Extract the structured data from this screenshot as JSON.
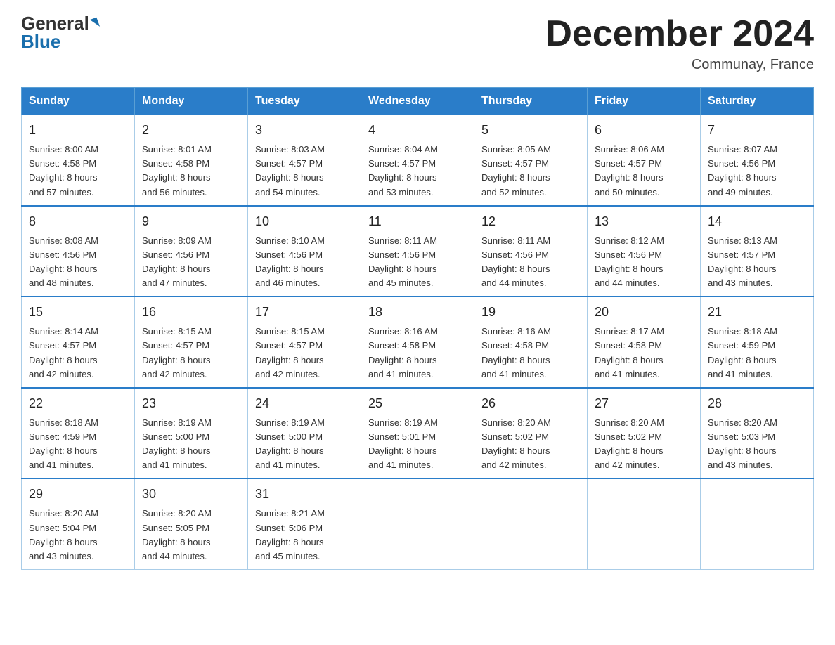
{
  "header": {
    "logo_general": "General",
    "logo_blue": "Blue",
    "month_title": "December 2024",
    "location": "Communay, France"
  },
  "days_of_week": [
    "Sunday",
    "Monday",
    "Tuesday",
    "Wednesday",
    "Thursday",
    "Friday",
    "Saturday"
  ],
  "weeks": [
    [
      {
        "day": "1",
        "sunrise": "8:00 AM",
        "sunset": "4:58 PM",
        "daylight": "8 hours and 57 minutes."
      },
      {
        "day": "2",
        "sunrise": "8:01 AM",
        "sunset": "4:58 PM",
        "daylight": "8 hours and 56 minutes."
      },
      {
        "day": "3",
        "sunrise": "8:03 AM",
        "sunset": "4:57 PM",
        "daylight": "8 hours and 54 minutes."
      },
      {
        "day": "4",
        "sunrise": "8:04 AM",
        "sunset": "4:57 PM",
        "daylight": "8 hours and 53 minutes."
      },
      {
        "day": "5",
        "sunrise": "8:05 AM",
        "sunset": "4:57 PM",
        "daylight": "8 hours and 52 minutes."
      },
      {
        "day": "6",
        "sunrise": "8:06 AM",
        "sunset": "4:57 PM",
        "daylight": "8 hours and 50 minutes."
      },
      {
        "day": "7",
        "sunrise": "8:07 AM",
        "sunset": "4:56 PM",
        "daylight": "8 hours and 49 minutes."
      }
    ],
    [
      {
        "day": "8",
        "sunrise": "8:08 AM",
        "sunset": "4:56 PM",
        "daylight": "8 hours and 48 minutes."
      },
      {
        "day": "9",
        "sunrise": "8:09 AM",
        "sunset": "4:56 PM",
        "daylight": "8 hours and 47 minutes."
      },
      {
        "day": "10",
        "sunrise": "8:10 AM",
        "sunset": "4:56 PM",
        "daylight": "8 hours and 46 minutes."
      },
      {
        "day": "11",
        "sunrise": "8:11 AM",
        "sunset": "4:56 PM",
        "daylight": "8 hours and 45 minutes."
      },
      {
        "day": "12",
        "sunrise": "8:11 AM",
        "sunset": "4:56 PM",
        "daylight": "8 hours and 44 minutes."
      },
      {
        "day": "13",
        "sunrise": "8:12 AM",
        "sunset": "4:56 PM",
        "daylight": "8 hours and 44 minutes."
      },
      {
        "day": "14",
        "sunrise": "8:13 AM",
        "sunset": "4:57 PM",
        "daylight": "8 hours and 43 minutes."
      }
    ],
    [
      {
        "day": "15",
        "sunrise": "8:14 AM",
        "sunset": "4:57 PM",
        "daylight": "8 hours and 42 minutes."
      },
      {
        "day": "16",
        "sunrise": "8:15 AM",
        "sunset": "4:57 PM",
        "daylight": "8 hours and 42 minutes."
      },
      {
        "day": "17",
        "sunrise": "8:15 AM",
        "sunset": "4:57 PM",
        "daylight": "8 hours and 42 minutes."
      },
      {
        "day": "18",
        "sunrise": "8:16 AM",
        "sunset": "4:58 PM",
        "daylight": "8 hours and 41 minutes."
      },
      {
        "day": "19",
        "sunrise": "8:16 AM",
        "sunset": "4:58 PM",
        "daylight": "8 hours and 41 minutes."
      },
      {
        "day": "20",
        "sunrise": "8:17 AM",
        "sunset": "4:58 PM",
        "daylight": "8 hours and 41 minutes."
      },
      {
        "day": "21",
        "sunrise": "8:18 AM",
        "sunset": "4:59 PM",
        "daylight": "8 hours and 41 minutes."
      }
    ],
    [
      {
        "day": "22",
        "sunrise": "8:18 AM",
        "sunset": "4:59 PM",
        "daylight": "8 hours and 41 minutes."
      },
      {
        "day": "23",
        "sunrise": "8:19 AM",
        "sunset": "5:00 PM",
        "daylight": "8 hours and 41 minutes."
      },
      {
        "day": "24",
        "sunrise": "8:19 AM",
        "sunset": "5:00 PM",
        "daylight": "8 hours and 41 minutes."
      },
      {
        "day": "25",
        "sunrise": "8:19 AM",
        "sunset": "5:01 PM",
        "daylight": "8 hours and 41 minutes."
      },
      {
        "day": "26",
        "sunrise": "8:20 AM",
        "sunset": "5:02 PM",
        "daylight": "8 hours and 42 minutes."
      },
      {
        "day": "27",
        "sunrise": "8:20 AM",
        "sunset": "5:02 PM",
        "daylight": "8 hours and 42 minutes."
      },
      {
        "day": "28",
        "sunrise": "8:20 AM",
        "sunset": "5:03 PM",
        "daylight": "8 hours and 43 minutes."
      }
    ],
    [
      {
        "day": "29",
        "sunrise": "8:20 AM",
        "sunset": "5:04 PM",
        "daylight": "8 hours and 43 minutes."
      },
      {
        "day": "30",
        "sunrise": "8:20 AM",
        "sunset": "5:05 PM",
        "daylight": "8 hours and 44 minutes."
      },
      {
        "day": "31",
        "sunrise": "8:21 AM",
        "sunset": "5:06 PM",
        "daylight": "8 hours and 45 minutes."
      },
      null,
      null,
      null,
      null
    ]
  ],
  "labels": {
    "sunrise": "Sunrise:",
    "sunset": "Sunset:",
    "daylight": "Daylight:"
  }
}
